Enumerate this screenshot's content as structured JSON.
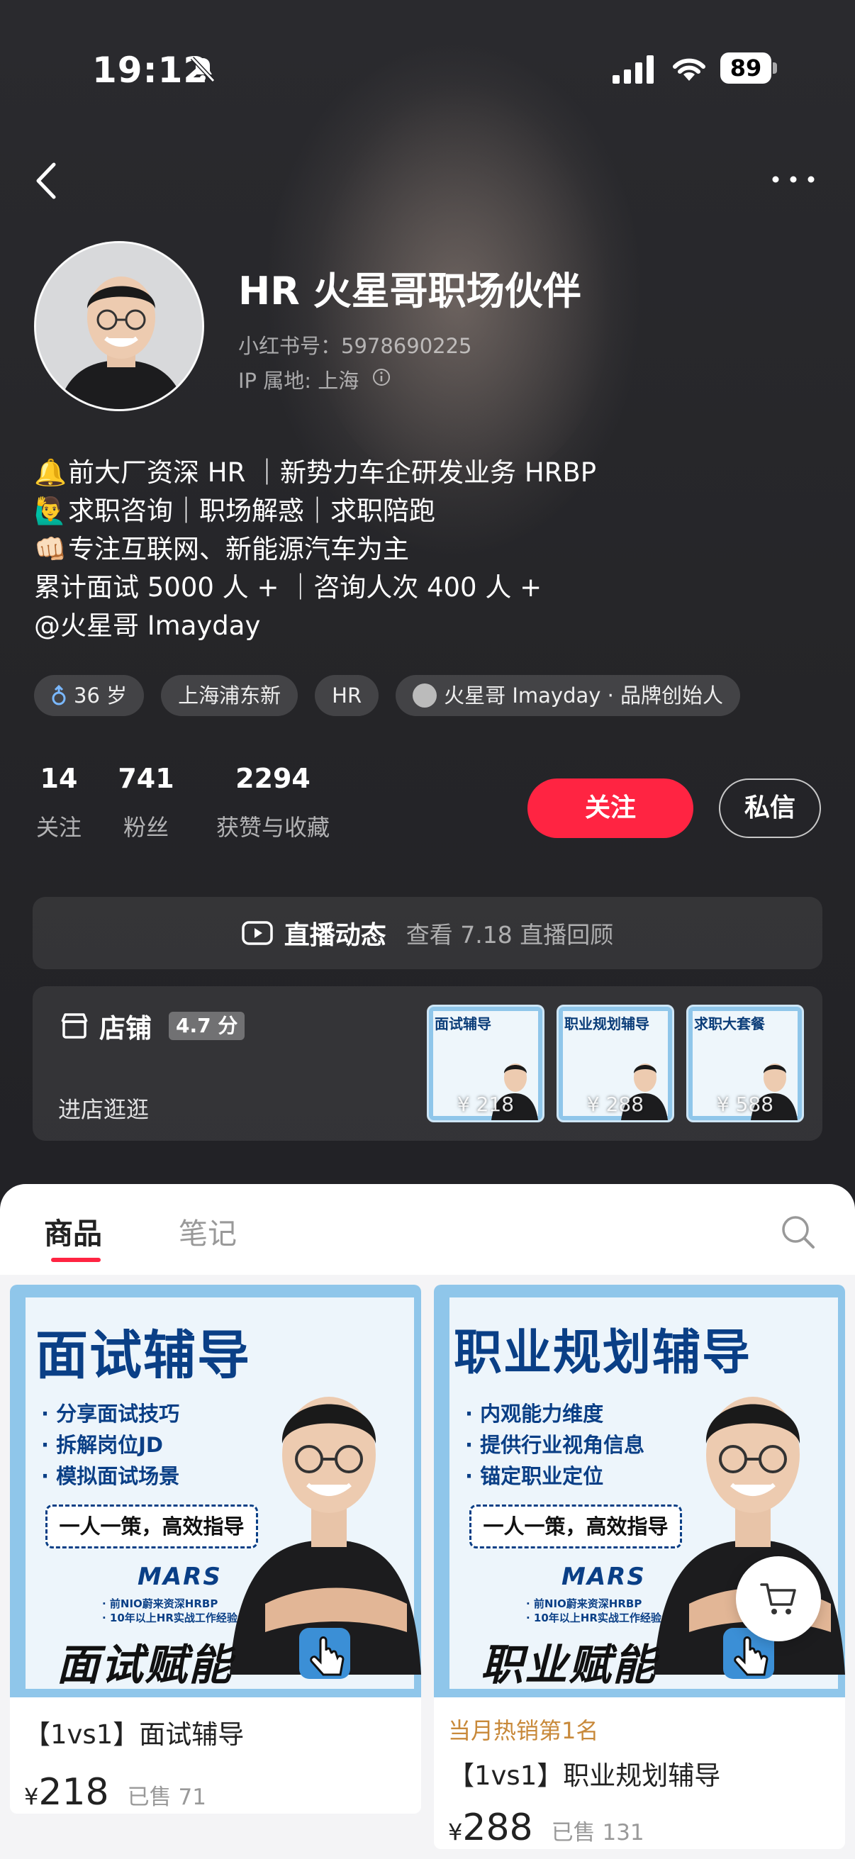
{
  "status_bar": {
    "time": "19:12",
    "battery": "89"
  },
  "profile": {
    "name": "HR 火星哥职场伙伴",
    "rednote_id": "小红书号：5978690225",
    "ip_location": "IP 属地: 上海"
  },
  "bio": [
    {
      "emoji": "🔔",
      "text": "前大厂资深 HR ｜新势力车企研发业务 HRBP"
    },
    {
      "emoji": "🙋‍♂️",
      "text": "求职咨询｜职场解惑｜求职陪跑"
    },
    {
      "emoji": "👊🏻",
      "text": "专注互联网、新能源汽车为主"
    },
    {
      "emoji": "",
      "text": "累计面试 5000 人 + ｜咨询人次 400 人 +"
    },
    {
      "emoji": "",
      "text": "@火星哥 Imayday"
    }
  ],
  "tags": {
    "age": "36 岁",
    "location": "上海浦东新",
    "job": "HR",
    "brand": "火星哥 Imayday · 品牌创始人"
  },
  "stats": {
    "following": {
      "value": "14",
      "label": "关注"
    },
    "followers": {
      "value": "741",
      "label": "粉丝"
    },
    "likes": {
      "value": "2294",
      "label": "获赞与收藏"
    }
  },
  "actions": {
    "follow": "关注",
    "message": "私信"
  },
  "live": {
    "title": "直播动态",
    "subtitle": "查看 7.18 直播回顾"
  },
  "shop": {
    "title": "店铺",
    "score": "4.7 分",
    "enter": "进店逛逛",
    "thumbs": [
      {
        "title": "面试辅导",
        "price": "¥ 218"
      },
      {
        "title": "职业规划辅导",
        "price": "¥ 288"
      },
      {
        "title": "求职大套餐",
        "price": "¥ 588"
      }
    ]
  },
  "tabs": {
    "products": "商品",
    "notes": "笔记"
  },
  "products": [
    {
      "image_title": "面试辅导",
      "bullets": [
        "· 分享面试技巧",
        "· 拆解岗位JD",
        "· 模拟面试场景"
      ],
      "box": "一人一策，高效指导",
      "mars": "MARS",
      "small1": "· 前NIO蔚来资深HRBP",
      "small2": "· 10年以上HR实战工作经验",
      "bottom": "面试赋能",
      "badge": "",
      "title": "【1vs1】面试辅导",
      "yen": "¥",
      "price": "218",
      "sold": "已售 71"
    },
    {
      "image_title": "职业规划辅导",
      "bullets": [
        "· 内观能力维度",
        "· 提供行业视角信息",
        "· 锚定职业定位"
      ],
      "box": "一人一策，高效指导",
      "mars": "MARS",
      "small1": "· 前NIO蔚来资深HRBP",
      "small2": "· 10年以上HR实战工作经验",
      "bottom": "职业赋能",
      "badge": "当月热销第1名",
      "title": "【1vs1】职业规划辅导",
      "yen": "¥",
      "price": "288",
      "sold": "已售 131"
    }
  ],
  "colors": {
    "accent": "#ff2442",
    "hot": "#c8893a",
    "poster_blue": "#0a3f86"
  }
}
